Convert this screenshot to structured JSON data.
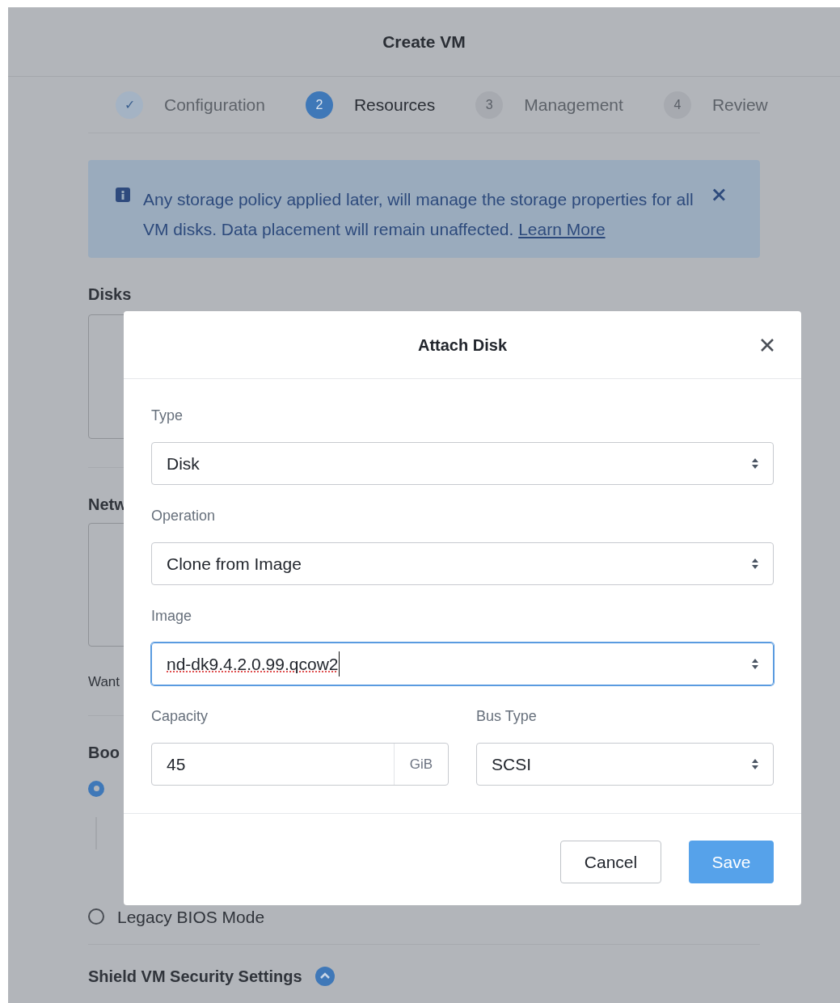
{
  "page": {
    "title": "Create VM"
  },
  "steps": [
    {
      "marker": "✓",
      "label": "Configuration",
      "completed": true,
      "selected": false
    },
    {
      "marker": "2",
      "label": "Resources",
      "completed": false,
      "selected": true
    },
    {
      "marker": "3",
      "label": "Management",
      "completed": false,
      "selected": false
    },
    {
      "marker": "4",
      "label": "Review",
      "completed": false,
      "selected": false
    }
  ],
  "banner": {
    "text": "Any storage policy applied later, will manage the storage properties for all VM disks. Data placement will remain unaffected.",
    "link": "Learn More"
  },
  "background_sections": {
    "disks_heading": "Disks",
    "network_heading": "Netw",
    "network_hint": "Want",
    "boot_heading": "Boo",
    "boot_options": [
      {
        "selected": true
      },
      {
        "label": "Legacy BIOS Mode",
        "selected": false
      }
    ],
    "shield_heading": "Shield VM Security Settings"
  },
  "dialog": {
    "title": "Attach Disk",
    "fields": [
      {
        "label": "Type",
        "value": "Disk",
        "focused": false
      },
      {
        "label": "Operation",
        "value": "Clone from Image",
        "focused": false
      },
      {
        "label": "Image",
        "value": "nd-dk9.4.2.0.99.qcow2",
        "focused": true
      }
    ],
    "capacity": {
      "label": "Capacity",
      "value": "45",
      "unit": "GiB"
    },
    "bus_type": {
      "label": "Bus Type",
      "value": "SCSI"
    },
    "buttons": [
      {
        "label": "Cancel",
        "kind": "secondary"
      },
      {
        "label": "Save",
        "kind": "primary"
      }
    ]
  }
}
